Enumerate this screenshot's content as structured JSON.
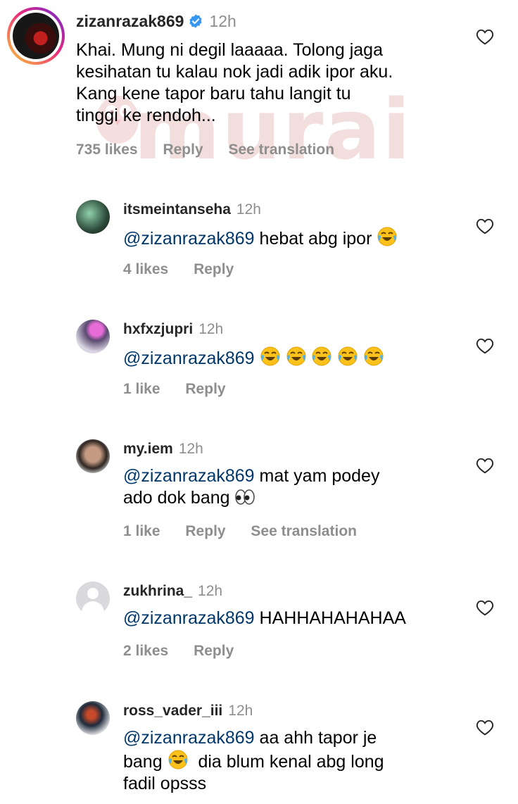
{
  "watermark": "murai",
  "colors": {
    "mention": "#00376b",
    "muted": "#8e8e8e",
    "verified": "#3897f0"
  },
  "main_comment": {
    "username": "zizanrazak869",
    "verified": true,
    "time": "12h",
    "lines": [
      "Khai. Mung ni degil laaaaa. Tolong jaga",
      "kesihatan tu kalau nok jadi adik ipor aku.",
      "Kang kene tapor baru tahu langit tu",
      "tinggi ke rendoh..."
    ],
    "likes": "735 likes",
    "reply": "Reply",
    "see_translation": "See translation"
  },
  "replies": [
    {
      "username": "itsmeintanseha",
      "time": "12h",
      "mention": "@zizanrazak869",
      "text": " hebat abg ipor",
      "emoji_after": [
        "face-with-tears-of-joy"
      ],
      "likes": "4 likes",
      "reply": "Reply"
    },
    {
      "username": "hxfxzjupri",
      "time": "12h",
      "mention": "@zizanrazak869",
      "text": "",
      "emoji_after": [
        "face-with-tears-of-joy",
        "face-with-tears-of-joy",
        "face-with-tears-of-joy",
        "face-with-tears-of-joy",
        "face-with-tears-of-joy"
      ],
      "likes": "1 like",
      "reply": "Reply"
    },
    {
      "username": "my.iem",
      "time": "12h",
      "mention": "@zizanrazak869",
      "text": " mat yam podey",
      "line2": "ado dok bang",
      "line2_emoji": "eyes",
      "likes": "1 like",
      "reply": "Reply",
      "see_translation": "See translation"
    },
    {
      "username": "zukhrina_",
      "time": "12h",
      "mention": "@zizanrazak869",
      "text": " HAHHAHAHAHAA",
      "likes": "2 likes",
      "reply": "Reply"
    },
    {
      "username": "ross_vader_iii",
      "time": "12h",
      "mention": "@zizanrazak869",
      "text": " aa ahh tapor je",
      "line2_pre": "bang ",
      "line2_emoji": "face-with-tears-of-joy",
      "line2_post": "  dia blum kenal abg long",
      "line3": "fadil opsss"
    }
  ]
}
